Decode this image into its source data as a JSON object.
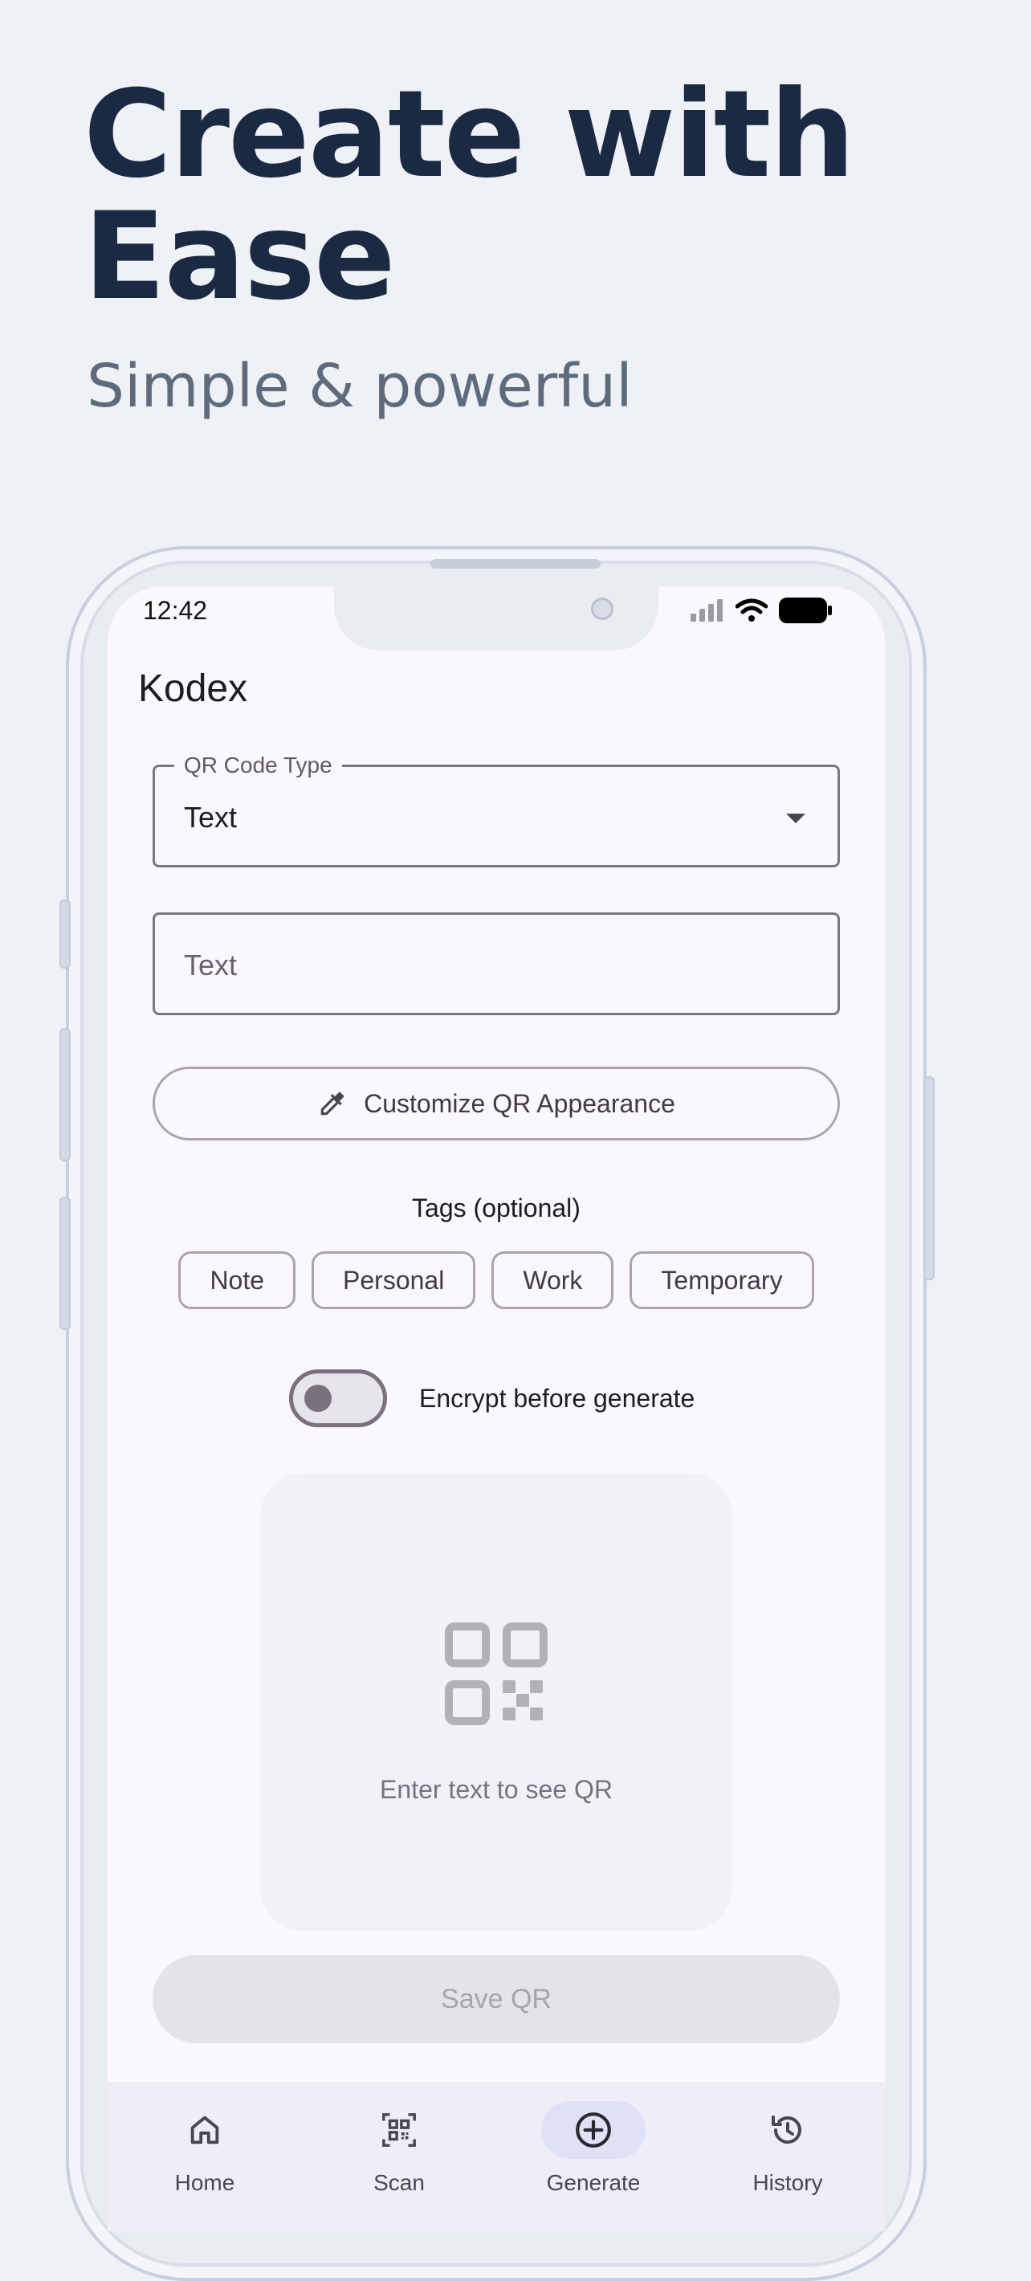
{
  "header": {
    "headline": "Create with Ease",
    "subline": "Simple & powerful"
  },
  "status_bar": {
    "time": "12:42"
  },
  "app": {
    "title": "Kodex",
    "qr_type_field": {
      "label": "QR Code Type",
      "value": "Text"
    },
    "text_field": {
      "placeholder": "Text"
    },
    "customize_button": {
      "label": "Customize QR Appearance",
      "icon": "eyedropper-icon"
    },
    "tags": {
      "label": "Tags (optional)",
      "items": [
        "Note",
        "Personal",
        "Work",
        "Temporary"
      ]
    },
    "encrypt_toggle": {
      "label": "Encrypt before generate",
      "on": false
    },
    "qr_preview": {
      "hint": "Enter text to see QR",
      "icon": "qr-code-icon"
    },
    "save_button": {
      "label": "Save QR",
      "enabled": false
    },
    "nav": {
      "items": [
        {
          "label": "Home",
          "icon": "home-icon",
          "active": false
        },
        {
          "label": "Scan",
          "icon": "qr-scan-icon",
          "active": false
        },
        {
          "label": "Generate",
          "icon": "add-circle-icon",
          "active": true
        },
        {
          "label": "History",
          "icon": "history-icon",
          "active": false
        }
      ]
    }
  },
  "colors": {
    "background": "#eef1f5",
    "headline": "#1b2a42",
    "active_nav": "#dfe2f7"
  }
}
